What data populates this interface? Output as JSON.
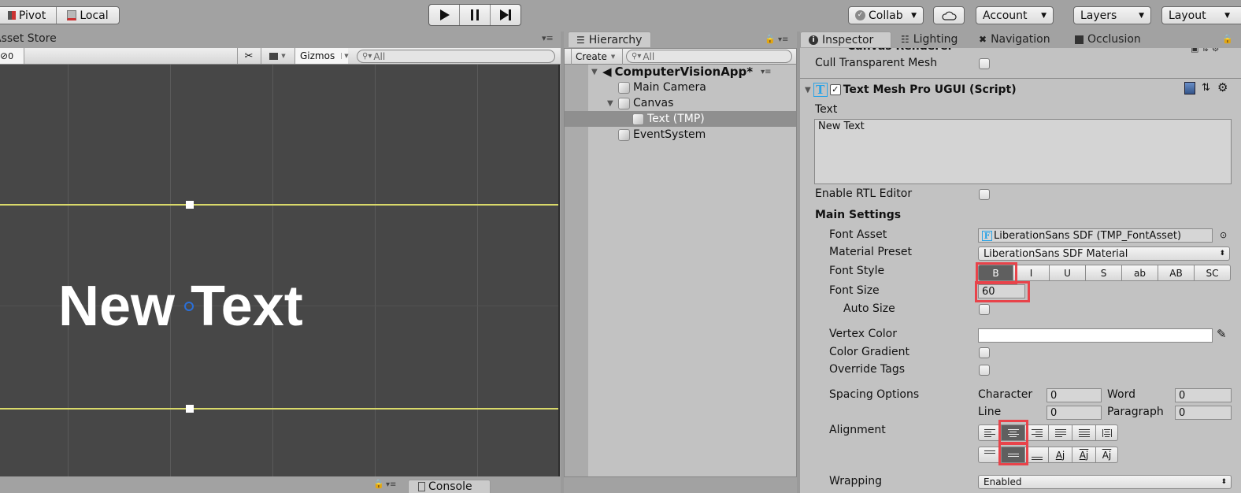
{
  "toolbar": {
    "pivot_label": "Pivot",
    "local_label": "Local",
    "collab_label": "Collab",
    "account_label": "Account",
    "layers_label": "Layers",
    "layout_label": "Layout"
  },
  "scene": {
    "tab_label": "Asset Store",
    "hidden_count": "0",
    "gizmos_label": "Gizmos",
    "search_placeholder": "All",
    "canvas_text": "New Text"
  },
  "hierarchy": {
    "tab_label": "Hierarchy",
    "create_label": "Create",
    "search_placeholder": "All",
    "scene_name": "ComputerVisionApp*",
    "items": [
      {
        "label": "Main Camera"
      },
      {
        "label": "Canvas"
      },
      {
        "label": "Text (TMP)"
      },
      {
        "label": "EventSystem"
      }
    ]
  },
  "tabs": {
    "inspector": "Inspector",
    "lighting": "Lighting",
    "navigation": "Navigation",
    "occlusion": "Occlusion"
  },
  "console": {
    "tab_label": "Console"
  },
  "inspector": {
    "canvas_renderer_title": "Canvas Renderer",
    "cull_transparent_mesh_label": "Cull Transparent Mesh",
    "component_title": "Text Mesh Pro UGUI (Script)",
    "text_label": "Text",
    "text_value": "New Text",
    "enable_rtl_label": "Enable RTL Editor",
    "main_settings_label": "Main Settings",
    "font_asset_label": "Font Asset",
    "font_asset_value": "LiberationSans SDF (TMP_FontAsset)",
    "material_preset_label": "Material Preset",
    "material_preset_value": "LiberationSans SDF Material",
    "font_style_label": "Font Style",
    "font_style_buttons": [
      "B",
      "I",
      "U",
      "S",
      "ab",
      "AB",
      "SC"
    ],
    "font_style_active": "B",
    "font_size_label": "Font Size",
    "font_size_value": "60",
    "auto_size_label": "Auto Size",
    "vertex_color_label": "Vertex Color",
    "vertex_color_value": "#ffffff",
    "color_gradient_label": "Color Gradient",
    "override_tags_label": "Override Tags",
    "spacing_options_label": "Spacing Options",
    "character_label": "Character",
    "character_value": "0",
    "word_label": "Word",
    "word_value": "0",
    "line_label": "Line",
    "line_value": "0",
    "paragraph_label": "Paragraph",
    "paragraph_value": "0",
    "alignment_label": "Alignment",
    "horizontal_alignment_active": "center",
    "vertical_alignment_active": "middle",
    "wrapping_label": "Wrapping",
    "wrapping_value": "Enabled"
  },
  "colors": {
    "highlight": "#e8434a",
    "selected_button": "#5f5f5f",
    "rect_line": "#d9d96a",
    "pivot": "#2a6fd8"
  }
}
